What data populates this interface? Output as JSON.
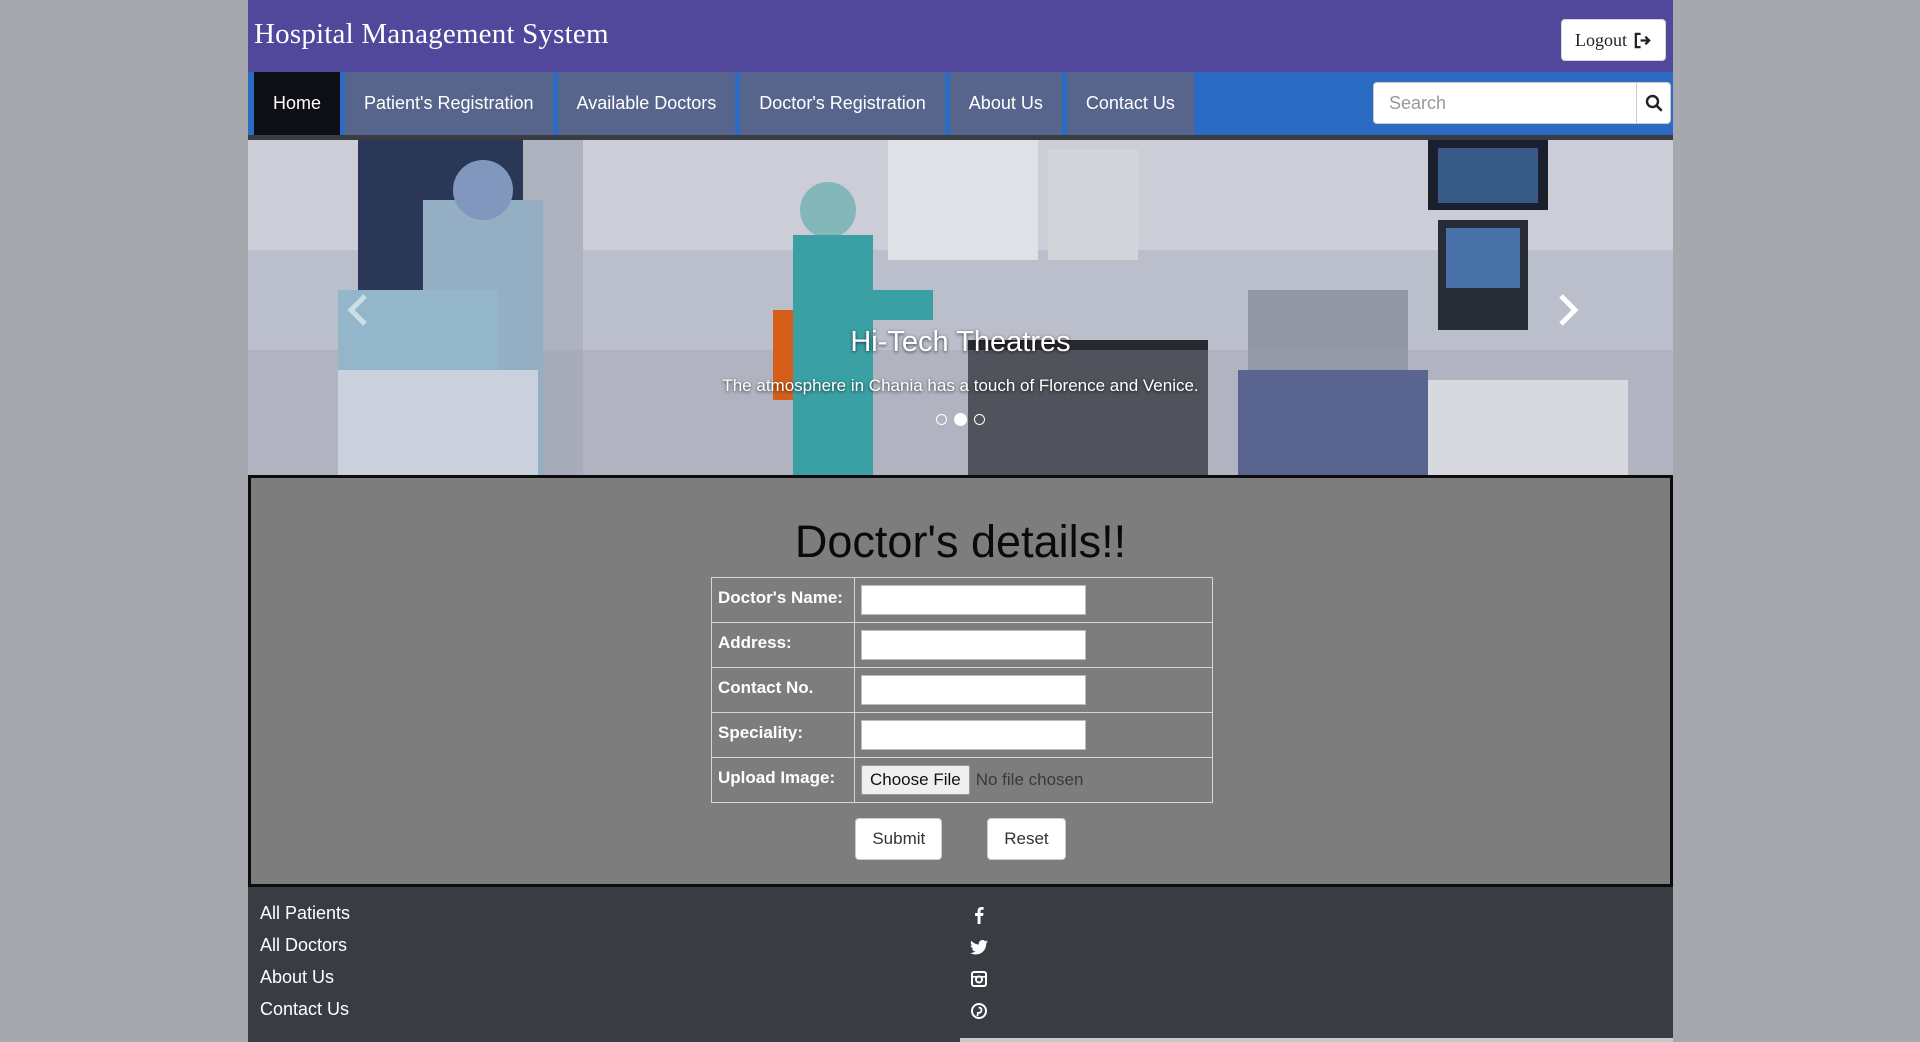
{
  "header": {
    "brand": "Hospital Management System",
    "logout_label": "Logout",
    "logout_icon": "sign-out-icon"
  },
  "nav": {
    "items": [
      {
        "label": "Home",
        "active": true
      },
      {
        "label": "Patient's Registration"
      },
      {
        "label": "Available Doctors"
      },
      {
        "label": "Doctor's Registration"
      },
      {
        "label": "About Us"
      },
      {
        "label": "Contact Us"
      }
    ],
    "search": {
      "placeholder": "Search",
      "value": "",
      "icon": "search-icon"
    }
  },
  "carousel": {
    "caption_title": "Hi-Tech Theatres",
    "caption_text": "The atmosphere in Chania has a touch of Florence and Venice.",
    "slides": 3,
    "active_slide": 2,
    "prev_icon": "chevron-left-icon",
    "next_icon": "chevron-right-icon"
  },
  "form": {
    "title": "Doctor's details!!",
    "fields": [
      {
        "label": "Doctor's Name:",
        "value": ""
      },
      {
        "label": "Address:",
        "value": ""
      },
      {
        "label": "Contact No.",
        "value": ""
      },
      {
        "label": "Speciality:",
        "value": ""
      }
    ],
    "upload": {
      "label": "Upload Image:",
      "button": "Choose File",
      "status": "No file chosen"
    },
    "submit_label": "Submit",
    "reset_label": "Reset"
  },
  "footer": {
    "links": [
      "All Patients",
      "All Doctors",
      "About Us",
      "Contact Us"
    ],
    "social_icons": [
      "facebook-icon",
      "twitter-icon",
      "instagram-icon",
      "pinterest-icon"
    ]
  },
  "colors": {
    "header_bg": "#51479b",
    "navbar_bg": "#2b6bc4",
    "nav_item_bg": "#57658c",
    "nav_active_bg": "#0d0f15",
    "panel_bg": "#7d7d7d",
    "footer_bg": "#3a3c44",
    "page_bg": "#a6a8ad"
  }
}
